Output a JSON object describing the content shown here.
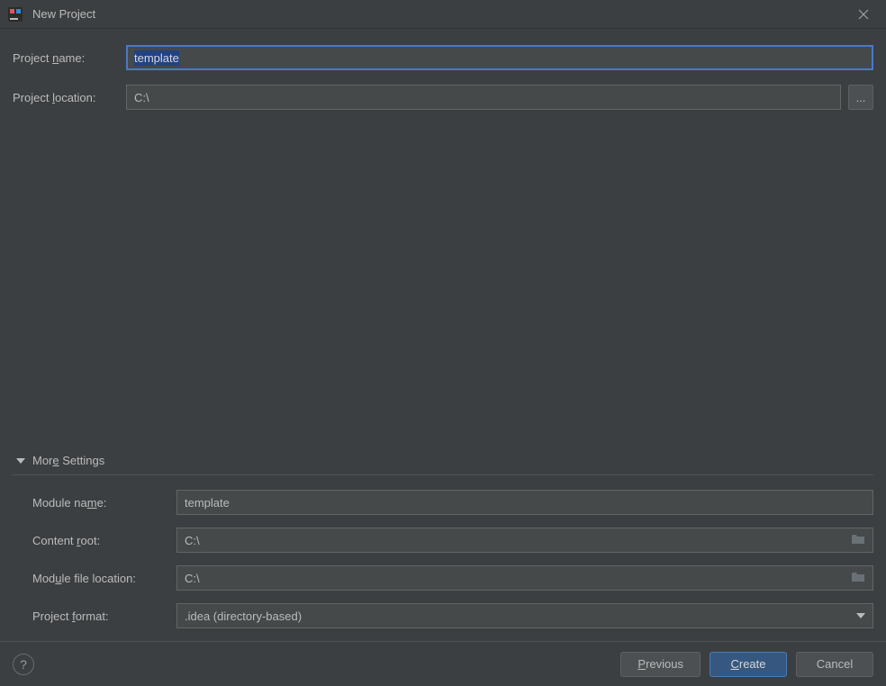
{
  "titlebar": {
    "title": "New Project"
  },
  "form": {
    "project_name_label_pre": "Project ",
    "project_name_label_m": "n",
    "project_name_label_post": "ame:",
    "project_name_value": "template",
    "project_location_label_pre": "Project ",
    "project_location_label_m": "l",
    "project_location_label_post": "ocation:",
    "project_location_value": "C:\\",
    "browse_label": "..."
  },
  "more": {
    "header_pre": "Mor",
    "header_m": "e",
    "header_post": " Settings",
    "module_name_label_pre": "Module na",
    "module_name_label_m": "m",
    "module_name_label_post": "e:",
    "module_name_value": "template",
    "content_root_label_pre": "Content ",
    "content_root_label_m": "r",
    "content_root_label_post": "oot:",
    "content_root_value": "C:\\",
    "module_file_loc_label_pre": "Mod",
    "module_file_loc_label_m": "u",
    "module_file_loc_label_post": "le file location:",
    "module_file_loc_value": "C:\\",
    "project_format_label_pre": "Project ",
    "project_format_label_m": "f",
    "project_format_label_post": "ormat:",
    "project_format_value": ".idea (directory-based)"
  },
  "footer": {
    "help_label": "?",
    "previous_m": "P",
    "previous_post": "revious",
    "create_m": "C",
    "create_post": "reate",
    "cancel_label": "Cancel"
  }
}
